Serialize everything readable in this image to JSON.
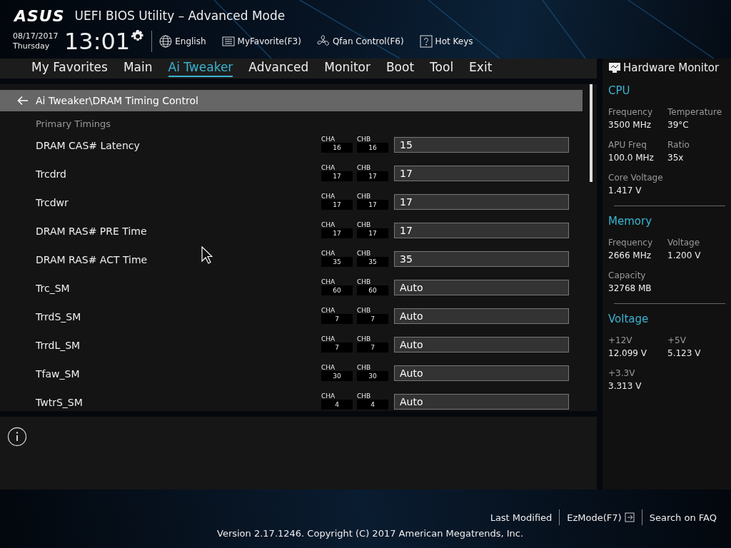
{
  "header": {
    "logo": "ASUS",
    "title": "UEFI BIOS Utility – Advanced Mode",
    "date": "08/17/2017",
    "day": "Thursday",
    "time": "13:01",
    "tools": [
      {
        "kind": "language",
        "label": "English"
      },
      {
        "kind": "favorite",
        "label": "MyFavorite(F3)"
      },
      {
        "kind": "fan",
        "label": "Qfan Control(F6)"
      },
      {
        "kind": "hotkeys",
        "label": "Hot Keys"
      }
    ]
  },
  "tabs": [
    {
      "label": "My Favorites",
      "selected": false
    },
    {
      "label": "Main",
      "selected": false
    },
    {
      "label": "Ai Tweaker",
      "selected": true
    },
    {
      "label": "Advanced",
      "selected": false
    },
    {
      "label": "Monitor",
      "selected": false
    },
    {
      "label": "Boot",
      "selected": false
    },
    {
      "label": "Tool",
      "selected": false
    },
    {
      "label": "Exit",
      "selected": false
    }
  ],
  "breadcrumb": "Ai Tweaker\\DRAM Timing Control",
  "section": "Primary Timings",
  "settings": [
    {
      "name": "DRAM CAS# Latency",
      "cha_label": "CHA",
      "cha": "16",
      "chb_label": "CHB",
      "chb": "16",
      "value": "15"
    },
    {
      "name": "Trcdrd",
      "cha_label": "CHA",
      "cha": "17",
      "chb_label": "CHB",
      "chb": "17",
      "value": "17"
    },
    {
      "name": "Trcdwr",
      "cha_label": "CHA",
      "cha": "17",
      "chb_label": "CHB",
      "chb": "17",
      "value": "17"
    },
    {
      "name": "DRAM RAS# PRE Time",
      "cha_label": "CHA",
      "cha": "17",
      "chb_label": "CHB",
      "chb": "17",
      "value": "17"
    },
    {
      "name": "DRAM RAS# ACT Time",
      "cha_label": "CHA",
      "cha": "35",
      "chb_label": "CHB",
      "chb": "35",
      "value": "35"
    },
    {
      "name": "Trc_SM",
      "cha_label": "CHA",
      "cha": "60",
      "chb_label": "CHB",
      "chb": "60",
      "value": "Auto"
    },
    {
      "name": "TrrdS_SM",
      "cha_label": "CHA",
      "cha": "7",
      "chb_label": "CHB",
      "chb": "7",
      "value": "Auto"
    },
    {
      "name": "TrrdL_SM",
      "cha_label": "CHA",
      "cha": "7",
      "chb_label": "CHB",
      "chb": "7",
      "value": "Auto"
    },
    {
      "name": "Tfaw_SM",
      "cha_label": "CHA",
      "cha": "30",
      "chb_label": "CHB",
      "chb": "30",
      "value": "Auto"
    },
    {
      "name": "TwtrS_SM",
      "cha_label": "CHA",
      "cha": "4",
      "chb_label": "CHB",
      "chb": "4",
      "value": "Auto"
    }
  ],
  "hardware_monitor": {
    "title": "Hardware Monitor",
    "groups": [
      {
        "title": "CPU",
        "items": [
          {
            "label": "Frequency",
            "value": "3500 MHz"
          },
          {
            "label": "Temperature",
            "value": "39°C"
          },
          {
            "label": "APU Freq",
            "value": "100.0 MHz"
          },
          {
            "label": "Ratio",
            "value": "35x"
          },
          {
            "label": "Core Voltage",
            "value": "1.417 V"
          }
        ]
      },
      {
        "title": "Memory",
        "items": [
          {
            "label": "Frequency",
            "value": "2666 MHz"
          },
          {
            "label": "Voltage",
            "value": "1.200 V"
          },
          {
            "label": "Capacity",
            "value": "32768 MB"
          }
        ]
      },
      {
        "title": "Voltage",
        "items": [
          {
            "label": "+12V",
            "value": "12.099 V"
          },
          {
            "label": "+5V",
            "value": "5.123 V"
          },
          {
            "label": "+3.3V",
            "value": "3.313 V"
          }
        ]
      }
    ]
  },
  "footer": {
    "links": [
      {
        "kind": "text",
        "label": "Last Modified"
      },
      {
        "kind": "ezmode",
        "label": "EzMode(F7)"
      },
      {
        "kind": "text",
        "label": "Search on FAQ"
      }
    ],
    "version": "Version 2.17.1246. Copyright (C) 2017 American Megatrends, Inc."
  }
}
